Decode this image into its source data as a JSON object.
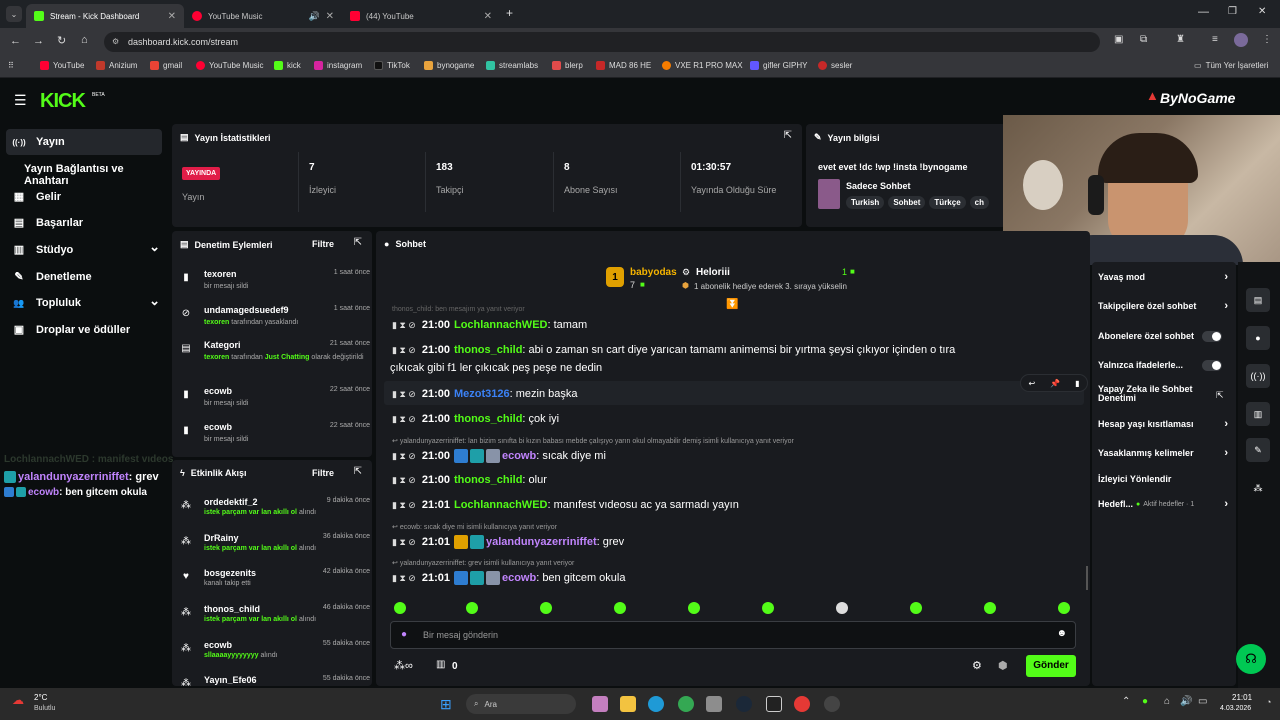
{
  "browser": {
    "tabs": [
      {
        "label": "Stream - Kick Dashboard",
        "active": true,
        "color": "#53fc18"
      },
      {
        "label": "YouTube Music",
        "active": false,
        "color": "#ff0033"
      },
      {
        "label": "(44) YouTube",
        "active": false,
        "color": "#ff0033"
      }
    ],
    "url": "dashboard.kick.com/stream",
    "bookmarks": [
      "YouTube",
      "Anizium",
      "gmail",
      "YouTube Music",
      "kick",
      "instagram",
      "TikTok",
      "bynogame",
      "streamlabs",
      "blerp",
      "MAD 86 HE",
      "VXE R1 PRO MAX",
      "gifler GIPHY",
      "sesler"
    ],
    "all_bookmarks": "Tüm Yer İşaretleri"
  },
  "kick": {
    "logo": "KICK",
    "logo_sup": "BETA",
    "sponsor": "ByNoGame",
    "sidebar": [
      {
        "label": "Yayın",
        "icon": "broadcast-icon",
        "glyph": "((·))"
      },
      {
        "label": "Yayın Bağlantısı ve Anahtarı",
        "icon": "",
        "glyph": ""
      },
      {
        "label": "Gelir",
        "icon": "income-icon",
        "glyph": "▦"
      },
      {
        "label": "Başarılar",
        "icon": "achievement-icon",
        "glyph": "▤"
      },
      {
        "label": "Stüdyo",
        "icon": "studio-icon",
        "glyph": "▥",
        "chev": "⌄"
      },
      {
        "label": "Denetleme",
        "icon": "wrench-icon",
        "glyph": "✎"
      },
      {
        "label": "Topluluk",
        "icon": "community-icon",
        "glyph": "👥",
        "chev": "⌄"
      },
      {
        "label": "Droplar ve ödüller",
        "icon": "gift-icon",
        "glyph": "▣"
      }
    ],
    "stats": {
      "title": "Yayın İstatistikleri",
      "live_badge": "YAYINDA",
      "live_label": "Yayın",
      "items": [
        {
          "value": "7",
          "label": "İzleyici"
        },
        {
          "value": "183",
          "label": "Takipçi"
        },
        {
          "value": "8",
          "label": "Abone Sayısı"
        },
        {
          "value": "01:30:57",
          "label": "Yayında Olduğu Süre"
        }
      ]
    },
    "info": {
      "title": "Yayın bilgisi",
      "stream_title": "evet evet !dc !wp !insta !bynogame",
      "category": "Sadece Sohbet",
      "tags": [
        "Turkish",
        "Sohbet",
        "Türkçe",
        "ch"
      ]
    },
    "mod": {
      "title": "Denetim Eylemleri",
      "filter": "Filtre",
      "items": [
        {
          "user": "texoren",
          "desc": "bir mesajı sildi",
          "time": "1 saat önce",
          "icon": "trash-icon",
          "glyph": "🗑"
        },
        {
          "user": "undamagedsuedef9",
          "desc_user": "texoren",
          "desc": "tarafından yasaklandı",
          "time": "1 saat önce",
          "icon": "ban-icon",
          "glyph": "⊘"
        },
        {
          "user": "Kategori",
          "desc_user": "texoren",
          "desc": "tarafından",
          "desc_green": "Just Chatting",
          "desc2": "olarak değiştirildi",
          "time": "21 saat önce",
          "icon": "category-icon",
          "glyph": "▤"
        },
        {
          "user": "ecowb",
          "desc": "bir mesajı sildi",
          "time": "22 saat önce",
          "icon": "trash-icon",
          "glyph": "🗑"
        },
        {
          "user": "ecowb",
          "desc": "bir mesajı sildi",
          "time": "22 saat önce",
          "icon": "trash-icon",
          "glyph": "🗑"
        }
      ]
    },
    "activity": {
      "title": "Etkinlik Akışı",
      "filter": "Filtre",
      "items": [
        {
          "user": "ordedektif_2",
          "green": "istek parçam var lan akıllı ol",
          "desc": "alındı",
          "time": "9 dakika önce",
          "icon": "reward-icon"
        },
        {
          "user": "DrRainy",
          "green": "istek parçam var lan akıllı ol",
          "desc": "alındı",
          "time": "36 dakika önce",
          "icon": "reward-icon"
        },
        {
          "user": "bosgezenits",
          "green": "",
          "desc": "kanalı takip etti",
          "time": "42 dakika önce",
          "icon": "heart-icon"
        },
        {
          "user": "thonos_child",
          "green": "istek parçam var lan akıllı ol",
          "desc": "alındı",
          "time": "46 dakika önce",
          "icon": "reward-icon"
        },
        {
          "user": "ecowb",
          "green": "sllaaaayyyyyyyy",
          "desc": "alındı",
          "time": "55 dakika önce",
          "icon": "reward-icon"
        },
        {
          "user": "Yayın_Efe06",
          "green": "",
          "desc": "",
          "time": "55 dakika önce",
          "icon": "reward-icon"
        }
      ]
    },
    "chat": {
      "title": "Sohbet",
      "pinned_gift_user": "babyodas",
      "pinned_gift_count": "7",
      "pinned_user": "Heloriii",
      "pinned_count": "1",
      "pinned_text": "1 abonelik hediye ederek 3. sıraya yükselin",
      "top_reply": "thonos_child: ben mesajım ya yanıt veriyor",
      "messages": [
        {
          "reply": "",
          "time": "21:00",
          "user": "LochlannachWED",
          "color": "#53fc18",
          "text": ": tamam",
          "badges": []
        },
        {
          "reply": "",
          "time": "21:00",
          "user": "thonos_child",
          "color": "#53fc18",
          "text": ": abi o zaman sn cart diye yarıcan tamamı animemsi bir yırtma şeysi çıkıyor içinden o tıra",
          "text2": "çıkıcak gibi f1 ler çıkıcak peş peşe ne dedin",
          "badges": []
        },
        {
          "reply": "",
          "time": "21:00",
          "user": "Mezot3126",
          "color": "#3b82f6",
          "text": ": mezin başka",
          "badges": []
        },
        {
          "reply": "",
          "time": "21:00",
          "user": "thonos_child",
          "color": "#53fc18",
          "text": ": çok iyi",
          "badges": []
        },
        {
          "reply": "yalandunyazerriniffet: lan bizim sınıfta bi kızın babası mebde çalışıyo yarın okul olmayabilir demiş isimli kullanıcıya yanıt veriyor",
          "time": "21:00",
          "user": "ecowb",
          "color": "#c084fc",
          "text": ": sıcak diye mi",
          "badges": [
            "#2e7dd1",
            "#1e9fa8",
            "#8893a8"
          ]
        },
        {
          "reply": "",
          "time": "21:00",
          "user": "thonos_child",
          "color": "#53fc18",
          "text": ": olur",
          "badges": []
        },
        {
          "reply": "",
          "time": "21:01",
          "user": "LochlannachWED",
          "color": "#53fc18",
          "text": ": manıfest vıdeosu ac ya sarmadı yayın",
          "badges": []
        },
        {
          "reply": "ecowb: sıcak diye mi isimli kullanıcıya yanıt veriyor",
          "time": "21:01",
          "user": "yalandunyazerriniffet",
          "color": "#c084fc",
          "text": ": grev",
          "badges": [
            "#e0a000",
            "#1e9fa8"
          ]
        },
        {
          "reply": "yalandunyazerriniffet: grev isimli kullanıcıya yanıt veriyor",
          "time": "21:01",
          "user": "ecowb",
          "color": "#c084fc",
          "text": ": ben gitcem okula",
          "badges": [
            "#2e7dd1",
            "#1e9fa8",
            "#8893a8"
          ]
        }
      ],
      "input_placeholder": "Bir mesaj gönderin",
      "points": "0",
      "send": "Gönder"
    },
    "overlay": {
      "line1": "LochlannachWED : manifest vıdeosu ac ya sarmadı yayın",
      "line2_user": "yalandunyazerriniffet",
      "line2_text": ": grev",
      "line3_user": "ecowb",
      "line3_text": ": ben gitcem okula"
    },
    "settings": [
      {
        "label": "Yavaş mod",
        "kind": "arrow"
      },
      {
        "label": "Takipçilere özel sohbet",
        "kind": "arrow"
      },
      {
        "label": "Abonelere özel sohbet",
        "kind": "toggle"
      },
      {
        "label": "Yalnızca ifadelerle...",
        "kind": "toggle"
      },
      {
        "label": "Yapay Zeka ile Sohbet Denetimi",
        "kind": "ext"
      },
      {
        "label": "Hesap yaşı kısıtlaması",
        "kind": "arrow"
      },
      {
        "label": "Yasaklanmış kelimeler",
        "kind": "arrow"
      },
      {
        "label": "İzleyici Yönlendir",
        "kind": "none"
      },
      {
        "label": "Hedefl...",
        "sub": "Aktif hedefler · 1",
        "kind": "arrow"
      }
    ]
  },
  "taskbar": {
    "temp": "2°C",
    "weather": "Bulutlu",
    "search": "Ara",
    "time": "21:01",
    "date": "4.03.2026"
  },
  "colors": {
    "accent": "#53fc18",
    "panel": "#191b1f",
    "bg": "#0b0e0f",
    "live": "#e11d48"
  }
}
